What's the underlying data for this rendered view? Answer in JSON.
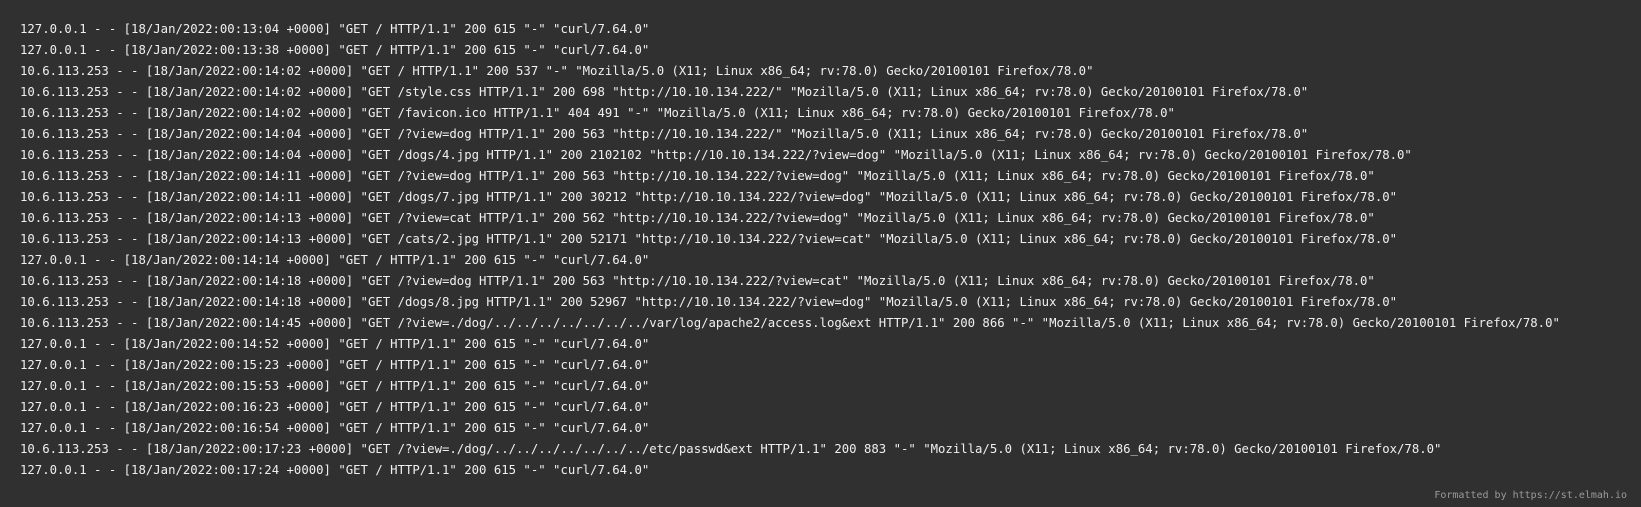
{
  "log": {
    "lines": [
      "127.0.0.1 - - [18/Jan/2022:00:13:04 +0000] \"GET / HTTP/1.1\" 200 615 \"-\" \"curl/7.64.0\"",
      "127.0.0.1 - - [18/Jan/2022:00:13:38 +0000] \"GET / HTTP/1.1\" 200 615 \"-\" \"curl/7.64.0\"",
      "10.6.113.253 - - [18/Jan/2022:00:14:02 +0000] \"GET / HTTP/1.1\" 200 537 \"-\" \"Mozilla/5.0 (X11; Linux x86_64; rv:78.0) Gecko/20100101 Firefox/78.0\"",
      "10.6.113.253 - - [18/Jan/2022:00:14:02 +0000] \"GET /style.css HTTP/1.1\" 200 698 \"http://10.10.134.222/\" \"Mozilla/5.0 (X11; Linux x86_64; rv:78.0) Gecko/20100101 Firefox/78.0\"",
      "10.6.113.253 - - [18/Jan/2022:00:14:02 +0000] \"GET /favicon.ico HTTP/1.1\" 404 491 \"-\" \"Mozilla/5.0 (X11; Linux x86_64; rv:78.0) Gecko/20100101 Firefox/78.0\"",
      "10.6.113.253 - - [18/Jan/2022:00:14:04 +0000] \"GET /?view=dog HTTP/1.1\" 200 563 \"http://10.10.134.222/\" \"Mozilla/5.0 (X11; Linux x86_64; rv:78.0) Gecko/20100101 Firefox/78.0\"",
      "10.6.113.253 - - [18/Jan/2022:00:14:04 +0000] \"GET /dogs/4.jpg HTTP/1.1\" 200 2102102 \"http://10.10.134.222/?view=dog\" \"Mozilla/5.0 (X11; Linux x86_64; rv:78.0) Gecko/20100101 Firefox/78.0\"",
      "10.6.113.253 - - [18/Jan/2022:00:14:11 +0000] \"GET /?view=dog HTTP/1.1\" 200 563 \"http://10.10.134.222/?view=dog\" \"Mozilla/5.0 (X11; Linux x86_64; rv:78.0) Gecko/20100101 Firefox/78.0\"",
      "10.6.113.253 - - [18/Jan/2022:00:14:11 +0000] \"GET /dogs/7.jpg HTTP/1.1\" 200 30212 \"http://10.10.134.222/?view=dog\" \"Mozilla/5.0 (X11; Linux x86_64; rv:78.0) Gecko/20100101 Firefox/78.0\"",
      "10.6.113.253 - - [18/Jan/2022:00:14:13 +0000] \"GET /?view=cat HTTP/1.1\" 200 562 \"http://10.10.134.222/?view=dog\" \"Mozilla/5.0 (X11; Linux x86_64; rv:78.0) Gecko/20100101 Firefox/78.0\"",
      "10.6.113.253 - - [18/Jan/2022:00:14:13 +0000] \"GET /cats/2.jpg HTTP/1.1\" 200 52171 \"http://10.10.134.222/?view=cat\" \"Mozilla/5.0 (X11; Linux x86_64; rv:78.0) Gecko/20100101 Firefox/78.0\"",
      "127.0.0.1 - - [18/Jan/2022:00:14:14 +0000] \"GET / HTTP/1.1\" 200 615 \"-\" \"curl/7.64.0\"",
      "10.6.113.253 - - [18/Jan/2022:00:14:18 +0000] \"GET /?view=dog HTTP/1.1\" 200 563 \"http://10.10.134.222/?view=cat\" \"Mozilla/5.0 (X11; Linux x86_64; rv:78.0) Gecko/20100101 Firefox/78.0\"",
      "10.6.113.253 - - [18/Jan/2022:00:14:18 +0000] \"GET /dogs/8.jpg HTTP/1.1\" 200 52967 \"http://10.10.134.222/?view=dog\" \"Mozilla/5.0 (X11; Linux x86_64; rv:78.0) Gecko/20100101 Firefox/78.0\"",
      "10.6.113.253 - - [18/Jan/2022:00:14:45 +0000] \"GET /?view=./dog/../../../../../../../var/log/apache2/access.log&ext HTTP/1.1\" 200 866 \"-\" \"Mozilla/5.0 (X11; Linux x86_64; rv:78.0) Gecko/20100101 Firefox/78.0\"",
      "127.0.0.1 - - [18/Jan/2022:00:14:52 +0000] \"GET / HTTP/1.1\" 200 615 \"-\" \"curl/7.64.0\"",
      "127.0.0.1 - - [18/Jan/2022:00:15:23 +0000] \"GET / HTTP/1.1\" 200 615 \"-\" \"curl/7.64.0\"",
      "127.0.0.1 - - [18/Jan/2022:00:15:53 +0000] \"GET / HTTP/1.1\" 200 615 \"-\" \"curl/7.64.0\"",
      "127.0.0.1 - - [18/Jan/2022:00:16:23 +0000] \"GET / HTTP/1.1\" 200 615 \"-\" \"curl/7.64.0\"",
      "127.0.0.1 - - [18/Jan/2022:00:16:54 +0000] \"GET / HTTP/1.1\" 200 615 \"-\" \"curl/7.64.0\"",
      "10.6.113.253 - - [18/Jan/2022:00:17:23 +0000] \"GET /?view=./dog/../../../../../../../etc/passwd&ext HTTP/1.1\" 200 883 \"-\" \"Mozilla/5.0 (X11; Linux x86_64; rv:78.0) Gecko/20100101 Firefox/78.0\"",
      "127.0.0.1 - - [18/Jan/2022:00:17:24 +0000] \"GET / HTTP/1.1\" 200 615 \"-\" \"curl/7.64.0\""
    ]
  },
  "footer": {
    "credit": "Formatted by https://st.elmah.io"
  },
  "colors": {
    "background": "#303030",
    "text": "#f0f0f0",
    "footer_text": "#9a9a9a"
  }
}
